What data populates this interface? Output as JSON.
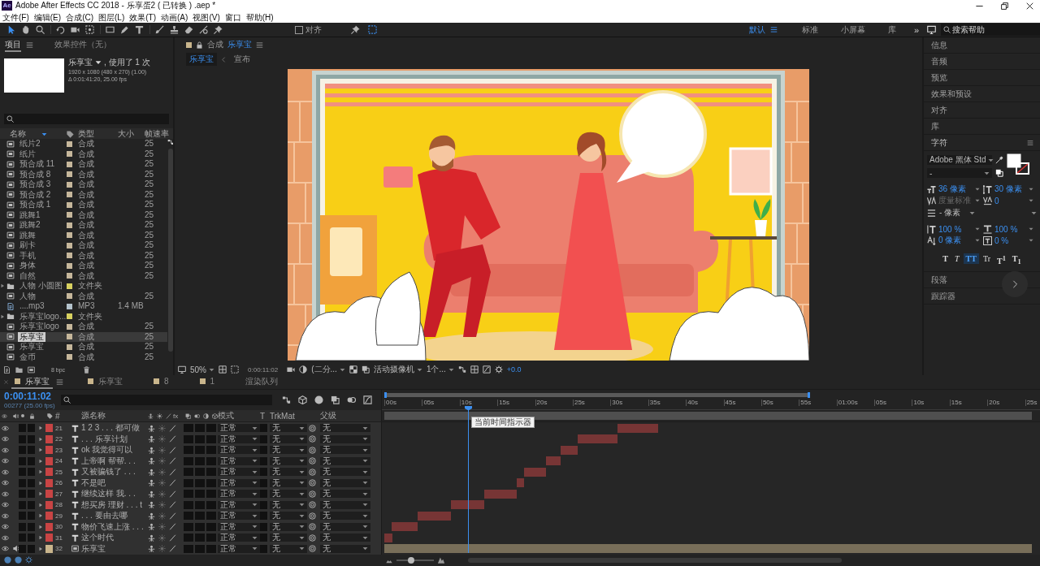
{
  "window": {
    "app_icon": "Ae",
    "title": "Adobe After Effects CC 2018 - 乐享蛋2 ( 已转换 ) .aep *"
  },
  "menu": [
    "文件(F)",
    "编辑(E)",
    "合成(C)",
    "图层(L)",
    "效果(T)",
    "动画(A)",
    "视图(V)",
    "窗口",
    "帮助(H)"
  ],
  "toolbar": {
    "tools": [
      {
        "kind": "selection",
        "selected": true
      },
      {
        "kind": "hand",
        "selected": false
      },
      {
        "kind": "zoom",
        "selected": false
      },
      {
        "kind": "rotate",
        "selected": false
      },
      {
        "kind": "camera",
        "selected": false
      },
      {
        "kind": "panbehind",
        "selected": false
      },
      {
        "kind": "rectangle",
        "selected": false
      },
      {
        "kind": "pen",
        "selected": false
      },
      {
        "kind": "type",
        "selected": false
      },
      {
        "kind": "brush",
        "selected": false
      },
      {
        "kind": "stamp",
        "selected": false
      },
      {
        "kind": "eraser",
        "selected": false
      },
      {
        "kind": "roto",
        "selected": false
      },
      {
        "kind": "pin",
        "selected": false
      }
    ],
    "snap": {
      "label": "对齐",
      "checked": false
    },
    "workspaces": [
      {
        "label": "默认",
        "selected": true
      },
      {
        "label": "标准",
        "selected": false
      },
      {
        "label": "小屏幕",
        "selected": false
      },
      {
        "label": "库",
        "selected": false
      }
    ],
    "more": "»",
    "search": {
      "placeholder": "搜索帮助"
    }
  },
  "project": {
    "tabs": [
      {
        "label": "项目",
        "selected": true
      },
      {
        "label": "效果控件（无）",
        "selected": false
      }
    ],
    "preview": {
      "name": "乐享宝",
      "usage": ", 使用了 1 次",
      "size": "1920 x 1080 (480 x 270) (1.00)",
      "duration": "Δ 0:01:41:20, 25.00 fps"
    },
    "columns": [
      "名称",
      "类型",
      "大小",
      "帧速率"
    ],
    "items": [
      {
        "name": "纸片2",
        "kind": "comp",
        "type": "合成",
        "fps": "25",
        "color": "#c6b79b",
        "selected": false
      },
      {
        "name": "纸片",
        "kind": "comp",
        "type": "合成",
        "fps": "25",
        "color": "#c6b79b",
        "selected": false
      },
      {
        "name": "预合成 11",
        "kind": "comp",
        "type": "合成",
        "fps": "25",
        "color": "#c6b79b",
        "selected": false
      },
      {
        "name": "预合成 8",
        "kind": "comp",
        "type": "合成",
        "fps": "25",
        "color": "#c6b79b",
        "selected": false
      },
      {
        "name": "预合成 3",
        "kind": "comp",
        "type": "合成",
        "fps": "25",
        "color": "#c6b79b",
        "selected": false
      },
      {
        "name": "预合成 2",
        "kind": "comp",
        "type": "合成",
        "fps": "25",
        "color": "#c6b79b",
        "selected": false
      },
      {
        "name": "预合成 1",
        "kind": "comp",
        "type": "合成",
        "fps": "25",
        "color": "#c6b79b",
        "selected": false
      },
      {
        "name": "跳舞1",
        "kind": "comp",
        "type": "合成",
        "fps": "25",
        "color": "#c6b79b",
        "selected": false
      },
      {
        "name": "跳舞2",
        "kind": "comp",
        "type": "合成",
        "fps": "25",
        "color": "#c6b79b",
        "selected": false
      },
      {
        "name": "跳舞",
        "kind": "comp",
        "type": "合成",
        "fps": "25",
        "color": "#c6b79b",
        "selected": false
      },
      {
        "name": "刷卡",
        "kind": "comp",
        "type": "合成",
        "fps": "25",
        "color": "#c6b79b",
        "selected": false
      },
      {
        "name": "手机",
        "kind": "comp",
        "type": "合成",
        "fps": "25",
        "color": "#c6b79b",
        "selected": false
      },
      {
        "name": "身体",
        "kind": "comp",
        "type": "合成",
        "fps": "25",
        "color": "#c6b79b",
        "selected": false
      },
      {
        "name": "自然",
        "kind": "comp",
        "type": "合成",
        "fps": "25",
        "color": "#c6b79b",
        "selected": false
      },
      {
        "name": "人物 小圆图",
        "kind": "folder",
        "type": "文件夹",
        "color": "#d8d160",
        "selected": false
      },
      {
        "name": "人物",
        "kind": "comp",
        "type": "合成",
        "fps": "25",
        "color": "#c6b79b",
        "selected": false
      },
      {
        "name": "....mp3",
        "kind": "audio",
        "type": "MP3",
        "size": "1.4 MB",
        "color": "#b4c3cc",
        "selected": false
      },
      {
        "name": "乐享宝logo...",
        "kind": "folder",
        "type": "文件夹",
        "color": "#d8d160",
        "selected": false
      },
      {
        "name": "乐享宝logo",
        "kind": "comp",
        "type": "合成",
        "fps": "25",
        "color": "#c6b79b",
        "selected": false
      },
      {
        "name": "乐享宝",
        "kind": "comp",
        "type": "合成",
        "fps": "25",
        "color": "#c6b79b",
        "selected": true
      },
      {
        "name": "乐享宝",
        "kind": "comp",
        "type": "合成",
        "fps": "25",
        "color": "#c6b79b",
        "selected": false
      },
      {
        "name": "金币",
        "kind": "comp",
        "type": "合成",
        "fps": "25",
        "color": "#c6b79b",
        "selected": false
      }
    ],
    "depth": "8 bpc"
  },
  "viewer": {
    "label": "合成",
    "composition": "乐享宝",
    "breadcrumbs": [
      {
        "label": "乐享宝",
        "selected": true
      },
      {
        "label": "宣布",
        "selected": false
      }
    ],
    "controls": {
      "zoom": "50%",
      "timecode": "0:00:11:02",
      "resolution": "(二分...",
      "camera": "活动摄像机",
      "views": "1个...",
      "exposure": "+0.0"
    }
  },
  "panels": [
    {
      "label": "信息",
      "expanded": false
    },
    {
      "label": "音频",
      "expanded": false
    },
    {
      "label": "预览",
      "expanded": false
    },
    {
      "label": "效果和预设",
      "expanded": false
    },
    {
      "label": "对齐",
      "expanded": false
    },
    {
      "label": "库",
      "expanded": false
    },
    {
      "label": "字符",
      "expanded": true
    },
    {
      "label": "段落",
      "expanded": false
    },
    {
      "label": "跟踪器",
      "expanded": false
    }
  ],
  "character": {
    "font": "Adobe 黑体 Std",
    "style": "-",
    "metrics": [
      {
        "kind": "size",
        "value": "36 像素",
        "disabled": false
      },
      {
        "kind": "leading",
        "value": "30 像素",
        "disabled": false
      },
      {
        "kind": "kerning",
        "value": "度量标准",
        "disabled": true
      },
      {
        "kind": "tracking",
        "value": "0",
        "disabled": false
      }
    ],
    "stroke": "- 像素",
    "scales": [
      {
        "kind": "vscale",
        "value": "100 %"
      },
      {
        "kind": "hscale",
        "value": "100 %"
      },
      {
        "kind": "baseline",
        "value": "0 像素"
      },
      {
        "kind": "tsume",
        "value": "0 %"
      }
    ],
    "styles": [
      {
        "kind": "bold",
        "label": "T",
        "selected": false
      },
      {
        "kind": "italic",
        "label": "T",
        "selected": false
      },
      {
        "kind": "caps",
        "label": "TT",
        "selected": true
      },
      {
        "kind": "smallcaps",
        "label": "Tr",
        "selected": false
      },
      {
        "kind": "super",
        "label": "T$^{1}$",
        "selected": false
      },
      {
        "kind": "sub",
        "label": "T$_{1}$",
        "selected": false
      }
    ]
  },
  "timeline": {
    "tabs": [
      {
        "kind": "comp",
        "label": "乐享宝",
        "selected": true
      },
      {
        "kind": "comp",
        "label": "乐享宝",
        "selected": false
      },
      {
        "kind": "comp",
        "label": "8",
        "selected": false
      },
      {
        "kind": "comp",
        "label": "1",
        "selected": false
      },
      {
        "kind": "queue",
        "label": "渲染队列",
        "selected": false
      }
    ],
    "timecode": "0:00:11:02",
    "frame": "00277 (25.00 fps)",
    "columns": {
      "number": "#",
      "name": "源名称",
      "fx": "fx",
      "mode": "模式",
      "t": "T",
      "trkmat": "TrkMat",
      "parent": "父级"
    },
    "layers": [
      {
        "number": "21",
        "kind": "text",
        "name": "1 2 3 . . . 都可做",
        "color": "#c84444",
        "visible": true,
        "audio": false,
        "solo": false,
        "locked": false,
        "motion_blur": false,
        "adjustment": false,
        "three_d": false,
        "preserve_transparency": false,
        "mode": "正常",
        "trkmat": "无",
        "parent": "无"
      },
      {
        "number": "22",
        "kind": "text",
        "name": ". . . 乐享计划",
        "color": "#c84444",
        "visible": true,
        "audio": false,
        "solo": false,
        "locked": false,
        "motion_blur": false,
        "adjustment": false,
        "three_d": false,
        "preserve_transparency": false,
        "mode": "正常",
        "trkmat": "无",
        "parent": "无"
      },
      {
        "number": "23",
        "kind": "text",
        "name": "ok 我觉得可以",
        "color": "#c84444",
        "visible": true,
        "audio": false,
        "solo": false,
        "locked": false,
        "motion_blur": false,
        "adjustment": false,
        "three_d": false,
        "preserve_transparency": false,
        "mode": "正常",
        "trkmat": "无",
        "parent": "无"
      },
      {
        "number": "24",
        "kind": "text",
        "name": "上帝啊 帮帮. . .",
        "color": "#c84444",
        "visible": true,
        "audio": false,
        "solo": false,
        "locked": false,
        "motion_blur": false,
        "adjustment": false,
        "three_d": false,
        "preserve_transparency": false,
        "mode": "正常",
        "trkmat": "无",
        "parent": "无"
      },
      {
        "number": "25",
        "kind": "text",
        "name": "又被骗钱了 . . .",
        "color": "#c84444",
        "visible": true,
        "audio": false,
        "solo": false,
        "locked": false,
        "motion_blur": false,
        "adjustment": false,
        "three_d": false,
        "preserve_transparency": false,
        "mode": "正常",
        "trkmat": "无",
        "parent": "无"
      },
      {
        "number": "26",
        "kind": "text",
        "name": "不是吧",
        "color": "#c84444",
        "visible": true,
        "audio": false,
        "solo": false,
        "locked": false,
        "motion_blur": false,
        "adjustment": false,
        "three_d": false,
        "preserve_transparency": false,
        "mode": "正常",
        "trkmat": "无",
        "parent": "无"
      },
      {
        "number": "27",
        "kind": "text",
        "name": "继续这样 我. . .",
        "color": "#c84444",
        "visible": true,
        "audio": false,
        "solo": false,
        "locked": false,
        "motion_blur": false,
        "adjustment": false,
        "three_d": false,
        "preserve_transparency": false,
        "mode": "正常",
        "trkmat": "无",
        "parent": "无"
      },
      {
        "number": "28",
        "kind": "text",
        "name": "想买房 理财 . . . t",
        "color": "#c84444",
        "visible": true,
        "audio": false,
        "solo": false,
        "locked": false,
        "motion_blur": false,
        "adjustment": false,
        "three_d": false,
        "preserve_transparency": false,
        "mode": "正常",
        "trkmat": "无",
        "parent": "无"
      },
      {
        "number": "29",
        "kind": "text",
        "name": ". . . 要由去哪",
        "color": "#c84444",
        "visible": true,
        "audio": false,
        "solo": false,
        "locked": false,
        "motion_blur": false,
        "adjustment": false,
        "three_d": false,
        "preserve_transparency": false,
        "mode": "正常",
        "trkmat": "无",
        "parent": "无"
      },
      {
        "number": "30",
        "kind": "text",
        "name": "物价飞速上涨 . . .",
        "color": "#c84444",
        "visible": true,
        "audio": false,
        "solo": false,
        "locked": false,
        "motion_blur": false,
        "adjustment": false,
        "three_d": false,
        "preserve_transparency": false,
        "mode": "正常",
        "trkmat": "无",
        "parent": "无"
      },
      {
        "number": "31",
        "kind": "text",
        "name": "这个时代",
        "color": "#c84444",
        "visible": true,
        "audio": false,
        "solo": false,
        "locked": false,
        "motion_blur": false,
        "adjustment": false,
        "three_d": false,
        "preserve_transparency": false,
        "mode": "正常",
        "trkmat": "无",
        "parent": "无"
      },
      {
        "number": "32",
        "kind": "comp",
        "name": "乐享宝",
        "color": "#c9b58c",
        "visible": true,
        "audio": true,
        "solo": false,
        "locked": false,
        "motion_blur": false,
        "adjustment": false,
        "three_d": false,
        "preserve_transparency": false,
        "mode": "正常",
        "trkmat": "无",
        "parent": "无"
      }
    ],
    "ruler": [
      "00s",
      "05s",
      "10s",
      "15s",
      "20s",
      "25s",
      "30s",
      "35s",
      "40s",
      "45s",
      "50s",
      "55s",
      "01:00s",
      "05s",
      "10s",
      "15s",
      "20s",
      "25s"
    ],
    "tooltip": "当前时间指示器",
    "zoom": {
      "level": 0.4
    }
  }
}
